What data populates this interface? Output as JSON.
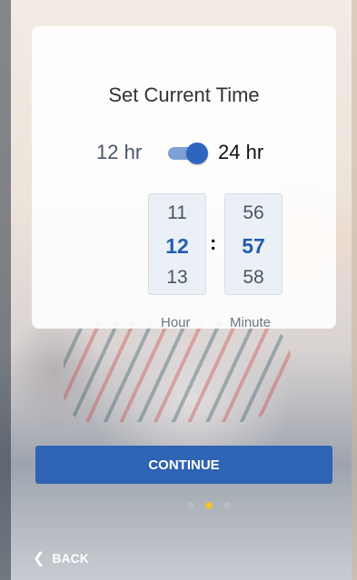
{
  "screen": {
    "title": "Set Current Time"
  },
  "format_toggle": {
    "left_label": "12 hr",
    "right_label": "24 hr",
    "selected": "24 hr",
    "accent_color": "#2c66be"
  },
  "time_picker": {
    "hour": {
      "prev": "11",
      "current": "12",
      "next": "13",
      "label": "Hour"
    },
    "separator": ":",
    "minute": {
      "prev": "56",
      "current": "57",
      "next": "58",
      "label": "Minute"
    }
  },
  "actions": {
    "continue_label": "CONTINUE",
    "back_label": "BACK",
    "back_icon": "chevron-left-icon"
  },
  "pagination": {
    "total": 3,
    "active_index": 1,
    "active_color": "#f2c12e"
  }
}
